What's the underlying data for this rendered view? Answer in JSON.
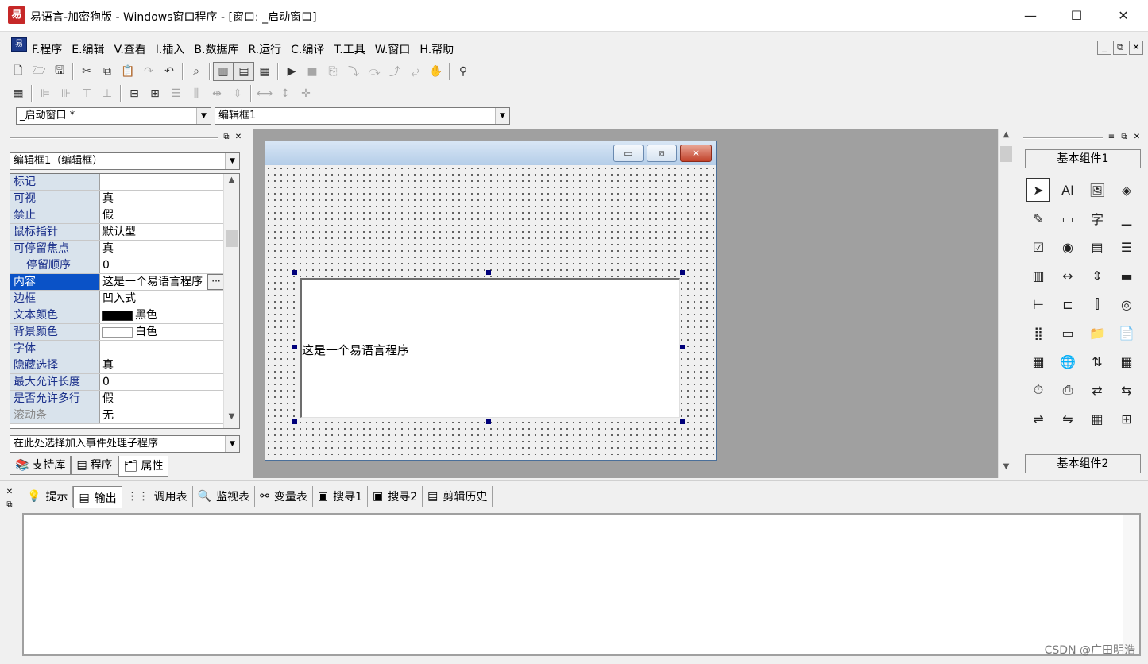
{
  "window": {
    "title": "易语言-加密狗版 - Windows窗口程序 - [窗口: _启动窗口]",
    "app_icon": "易",
    "minimize": "—",
    "maximize": "☐",
    "close": "✕"
  },
  "menu": {
    "items": [
      "F.程序",
      "E.编辑",
      "V.查看",
      "I.插入",
      "B.数据库",
      "R.运行",
      "C.编译",
      "T.工具",
      "W.窗口",
      "H.帮助"
    ],
    "mdi_min": "_",
    "mdi_restore": "⧉",
    "mdi_close": "✕"
  },
  "toolbar": {
    "window_combo": "_启动窗口 *",
    "component_combo": "编辑框1"
  },
  "properties": {
    "object_combo": "编辑框1（编辑框）",
    "rows": [
      {
        "name": "标记",
        "value": ""
      },
      {
        "name": "可视",
        "value": "真"
      },
      {
        "name": "禁止",
        "value": "假"
      },
      {
        "name": "鼠标指针",
        "value": "默认型"
      },
      {
        "name": "可停留焦点",
        "value": "真"
      },
      {
        "name": "停留顺序",
        "value": "0"
      },
      {
        "name": "内容",
        "value": "这是一个易语言程序"
      },
      {
        "name": "边框",
        "value": "凹入式"
      },
      {
        "name": "文本颜色",
        "value": "黑色"
      },
      {
        "name": "背景颜色",
        "value": "白色"
      },
      {
        "name": "字体",
        "value": ""
      },
      {
        "name": "隐藏选择",
        "value": "真"
      },
      {
        "name": "最大允许长度",
        "value": "0"
      },
      {
        "name": "是否允许多行",
        "value": "假"
      },
      {
        "name": "滚动条",
        "value": "无"
      }
    ],
    "ellipsis": "···",
    "event_combo": "在此处选择加入事件处理子程序",
    "tabs": [
      "支持库",
      "程序",
      "属性"
    ]
  },
  "design": {
    "editbox_text": "这是一个易语言程序",
    "form_min": "▭",
    "form_max": "⧈",
    "form_close": "✕"
  },
  "palette": {
    "top_button": "基本组件1",
    "bottom_button": "基本组件2",
    "icons": [
      "pointer-icon",
      "label-icon",
      "picture-icon",
      "shape-icon",
      "editbox-icon",
      "groupbox-icon",
      "text-icon",
      "button-icon",
      "checkbox-icon",
      "radio-icon",
      "combobox-icon",
      "listbox-icon",
      "list-icon",
      "hscroll-icon",
      "vscroll-icon",
      "progress-icon",
      "slider-icon",
      "tab-icon",
      "scroll-icon",
      "animation-icon",
      "grid-icon",
      "status-icon",
      "dir-icon",
      "file-icon",
      "color-icon",
      "globe-icon",
      "updown-icon",
      "calendar-icon",
      "timer-icon",
      "printer-icon",
      "client-icon",
      "server-icon",
      "port-icon",
      "netlink-icon",
      "table-icon",
      "split-icon"
    ],
    "glyphs": [
      "➤",
      "AI",
      "🖼",
      "◈",
      "✎",
      "▭",
      "字",
      "▁",
      "☑",
      "◉",
      "▤",
      "☰",
      "▥",
      "↔",
      "⇕",
      "▬",
      "⊢",
      "⊏",
      "⫿",
      "◎",
      "⣿",
      "▭",
      "📁",
      "📄",
      "▦",
      "🌐",
      "⇅",
      "▦",
      "⏱",
      "⎙",
      "⇄",
      "⇆",
      "⇌",
      "⇋",
      "▦",
      "⊞"
    ]
  },
  "output": {
    "tabs": [
      "提示",
      "输出",
      "调用表",
      "监视表",
      "变量表",
      "搜寻1",
      "搜寻2",
      "剪辑历史"
    ],
    "tab_icons": [
      "hint-icon",
      "output-icon",
      "callstack-icon",
      "watch-icon",
      "variables-icon",
      "search1-icon",
      "search2-icon",
      "clipboard-history-icon"
    ],
    "tab_glyphs": [
      "💡",
      "▤",
      "⋮⋮",
      "🔍",
      "⚯",
      "▣",
      "▣",
      "▤"
    ],
    "active": 1,
    "watermark": "CSDN @广田明浩"
  }
}
